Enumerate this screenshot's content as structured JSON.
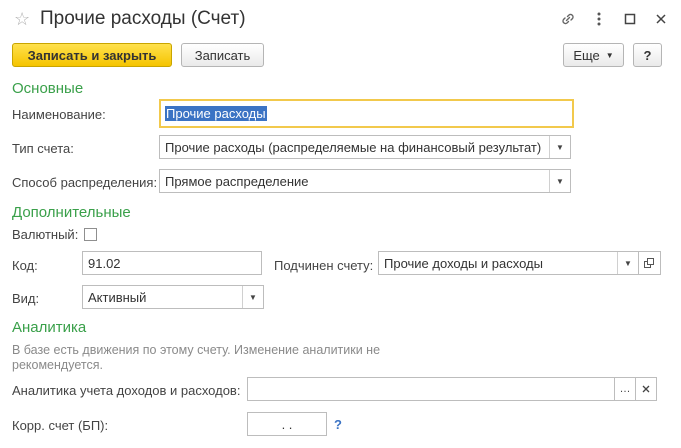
{
  "window": {
    "title": "Прочие расходы (Счет)"
  },
  "toolbar": {
    "save_close_label": "Записать и закрыть",
    "save_label": "Записать",
    "more_label": "Еще",
    "help_label": "?"
  },
  "sections": {
    "main": "Основные",
    "additional": "Дополнительные",
    "analytics": "Аналитика"
  },
  "fields": {
    "name_label": "Наименование:",
    "name_value": "Прочие расходы",
    "account_type_label": "Тип счета:",
    "account_type_value": "Прочие расходы (распределяемые на финансовый результат)",
    "distribution_label": "Способ распределения:",
    "distribution_value": "Прямое распределение",
    "currency_label": "Валютный:",
    "currency_checked": false,
    "code_label": "Код:",
    "code_value": "91.02",
    "parent_label": "Подчинен счету:",
    "parent_value": "Прочие доходы и расходы",
    "kind_label": "Вид:",
    "kind_value": "Активный",
    "analytics_note": "В базе есть движения по этому счету. Изменение аналитики не рекомендуется.",
    "analytics_label": "Аналитика учета доходов и расходов:",
    "analytics_value": "",
    "corr_label": "Корр. счет (БП):",
    "corr_value": ". .",
    "corr_help": "?"
  }
}
